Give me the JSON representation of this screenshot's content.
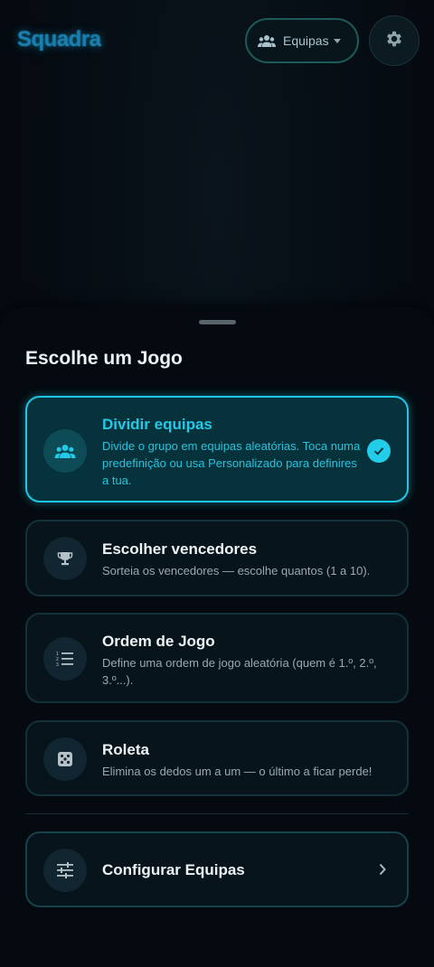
{
  "app": {
    "title": "Squadra"
  },
  "header": {
    "dropdown_label": "Equipas"
  },
  "sheet": {
    "title": "Escolhe um Jogo",
    "games": [
      {
        "title": "Dividir equipas",
        "description": "Divide o grupo em equipas aleatórias. Toca numa predefinição ou usa Personalizado para definires a tua.",
        "icon": "groups-icon",
        "selected": true
      },
      {
        "title": "Escolher vencedores",
        "description": "Sorteia os vencedores — escolhe quantos (1 a 10).",
        "icon": "trophy-icon",
        "selected": false
      },
      {
        "title": "Ordem de Jogo",
        "description": "Define uma ordem de jogo aleatória (quem é 1.º, 2.º, 3.º...).",
        "icon": "numbered-list-icon",
        "selected": false
      },
      {
        "title": "Roleta",
        "description": "Elimina os dedos um a um — o último a ficar perde!",
        "icon": "dice-icon",
        "selected": false
      }
    ],
    "configure": {
      "label": "Configurar Equipas",
      "icon": "sliders-icon"
    }
  },
  "colors": {
    "accent": "#22c9e8",
    "background": "#050b11"
  }
}
